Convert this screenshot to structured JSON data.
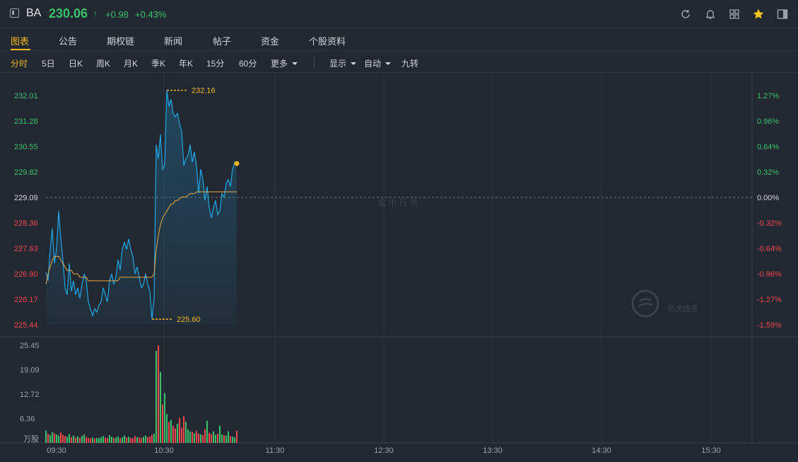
{
  "header": {
    "ticker": "BA",
    "price": "230.06",
    "arrow": "↑",
    "change": "+0.98",
    "change_pct": "+0.43%",
    "icons": [
      "panel-toggle-icon",
      "refresh-icon",
      "bell-icon",
      "grid-icon",
      "star-icon",
      "sidebar-icon"
    ],
    "colors": {
      "up": "#3ac16b",
      "down": "#f0464e",
      "accent": "#f2b518",
      "line": "#1ea7e8",
      "avg": "#f0a73c"
    }
  },
  "tabs": [
    {
      "label": "图表",
      "active": true
    },
    {
      "label": "公告",
      "active": false
    },
    {
      "label": "期权链",
      "active": false
    },
    {
      "label": "新闻",
      "active": false
    },
    {
      "label": "帖子",
      "active": false
    },
    {
      "label": "资金",
      "active": false
    },
    {
      "label": "个股资料",
      "active": false
    }
  ],
  "toolbar": {
    "periods": [
      {
        "label": "分时",
        "active": true
      },
      {
        "label": "5日",
        "active": false
      },
      {
        "label": "日K",
        "active": false
      },
      {
        "label": "周K",
        "active": false
      },
      {
        "label": "月K",
        "active": false
      },
      {
        "label": "季K",
        "active": false
      },
      {
        "label": "年K",
        "active": false
      },
      {
        "label": "15分",
        "active": false
      },
      {
        "label": "60分",
        "active": false
      }
    ],
    "more": "更多",
    "display": "显示",
    "auto": "自动",
    "nine_turn": "九转"
  },
  "chart_data": {
    "type": "line",
    "title": "",
    "watermark": "盘中行情",
    "brand": "老虎證券",
    "x_ticks": [
      "09:30",
      "10:30",
      "11:30",
      "12:30",
      "13:30",
      "14:30",
      "15:30"
    ],
    "price_ticks": [
      "232.01",
      "231.28",
      "230.55",
      "229.82",
      "229.09",
      "228.36",
      "227.63",
      "226.90",
      "226.17",
      "225.44"
    ],
    "pct_ticks": [
      "1.27%",
      "0.96%",
      "0.64%",
      "0.32%",
      "0.00%",
      "-0.32%",
      "-0.64%",
      "-0.96%",
      "-1.27%",
      "-1.59%"
    ],
    "volume_ticks": [
      "25.45",
      "19.09",
      "12.72",
      "6.36"
    ],
    "volume_unit": "万股",
    "prev_close": 229.09,
    "ylim": [
      225.44,
      232.01
    ],
    "high_label": "232.16",
    "low_label": "225.60",
    "price_series": [
      226.95,
      226.7,
      227.6,
      228.2,
      227.2,
      227.6,
      228.7,
      227.9,
      227.3,
      226.5,
      226.3,
      227.2,
      226.4,
      226.7,
      226.3,
      226.5,
      226.2,
      226.6,
      226.9,
      226.7,
      226.1,
      225.9,
      225.7,
      225.9,
      225.8,
      226.0,
      226.1,
      226.5,
      226.3,
      226.1,
      226.7,
      226.9,
      226.6,
      226.8,
      227.3,
      227.0,
      227.6,
      227.8,
      227.6,
      227.9,
      227.6,
      227.4,
      226.9,
      227.1,
      226.8,
      226.5,
      226.6,
      226.9,
      226.6,
      226.4,
      225.6,
      226.2,
      230.6,
      230.2,
      230.9,
      229.9,
      230.0,
      232.16,
      231.7,
      231.9,
      231.5,
      231.4,
      231.5,
      231.2,
      231.0,
      230.0,
      230.2,
      230.3,
      230.6,
      230.1,
      230.4,
      230.0,
      229.2,
      229.9,
      229.6,
      229.0,
      229.4,
      228.8,
      228.5,
      228.8,
      229.0,
      228.6,
      228.7,
      229.2,
      229.1,
      229.5,
      229.6,
      229.4,
      229.9,
      230.1,
      230.06
    ],
    "avg_series": [
      226.6,
      226.9,
      227.1,
      227.3,
      227.4,
      227.4,
      227.4,
      227.3,
      227.2,
      227.1,
      227.0,
      227.0,
      227.0,
      226.9,
      226.9,
      226.9,
      226.8,
      226.8,
      226.8,
      226.8,
      226.7,
      226.7,
      226.7,
      226.7,
      226.7,
      226.7,
      226.7,
      226.7,
      226.7,
      226.7,
      226.7,
      226.7,
      226.7,
      226.7,
      226.7,
      226.8,
      226.8,
      226.8,
      226.8,
      226.8,
      226.8,
      226.8,
      226.8,
      226.8,
      226.8,
      226.8,
      226.8,
      226.8,
      226.8,
      226.8,
      226.8,
      226.9,
      227.6,
      228.0,
      228.3,
      228.5,
      228.6,
      228.7,
      228.8,
      228.9,
      228.9,
      229.0,
      229.0,
      229.05,
      229.1,
      229.1,
      229.1,
      229.15,
      229.2,
      229.2,
      229.2,
      229.25,
      229.25,
      229.25,
      229.25,
      229.25,
      229.25,
      229.25,
      229.25,
      229.25,
      229.25,
      229.25,
      229.25,
      229.25,
      229.25,
      229.25,
      229.25,
      229.25,
      229.25,
      229.25,
      229.25
    ],
    "volume_series": [
      3.2,
      2.4,
      2.0,
      2.8,
      2.5,
      2.2,
      1.9,
      2.7,
      2.1,
      1.8,
      1.6,
      2.3,
      1.5,
      1.9,
      1.4,
      1.7,
      1.3,
      1.8,
      2.2,
      1.5,
      1.3,
      1.2,
      1.4,
      1.1,
      1.3,
      1.2,
      1.5,
      1.8,
      1.4,
      1.3,
      2.0,
      1.6,
      1.3,
      1.4,
      1.7,
      1.2,
      1.5,
      1.9,
      1.4,
      1.6,
      1.3,
      1.2,
      1.8,
      1.5,
      1.4,
      1.3,
      1.6,
      1.9,
      1.5,
      1.7,
      2.1,
      2.4,
      24.0,
      25.45,
      18.5,
      10.0,
      13.0,
      7.5,
      5.5,
      6.0,
      4.5,
      3.8,
      5.0,
      6.5,
      4.0,
      7.0,
      5.5,
      3.5,
      3.0,
      2.8,
      2.5,
      3.2,
      2.4,
      2.2,
      2.0,
      3.5,
      5.8,
      2.6,
      2.3,
      3.0,
      2.1,
      2.4,
      4.5,
      2.2,
      2.0,
      1.9,
      3.0,
      1.8,
      1.6,
      1.4,
      3.2
    ],
    "volume_up": [
      true,
      false,
      true,
      true,
      false,
      true,
      true,
      false,
      false,
      false,
      true,
      true,
      false,
      true,
      false,
      true,
      false,
      true,
      true,
      false,
      false,
      false,
      true,
      false,
      true,
      true,
      true,
      true,
      false,
      false,
      true,
      true,
      false,
      true,
      true,
      false,
      true,
      true,
      false,
      true,
      false,
      false,
      false,
      true,
      false,
      false,
      true,
      true,
      false,
      false,
      false,
      true,
      true,
      false,
      true,
      false,
      true,
      true,
      false,
      true,
      false,
      false,
      true,
      false,
      false,
      false,
      true,
      true,
      true,
      false,
      true,
      false,
      false,
      true,
      false,
      false,
      true,
      false,
      false,
      true,
      true,
      false,
      true,
      true,
      false,
      true,
      true,
      false,
      true,
      true,
      false
    ],
    "ylim_volume": [
      0,
      25.45
    ],
    "x_slots": 390
  }
}
